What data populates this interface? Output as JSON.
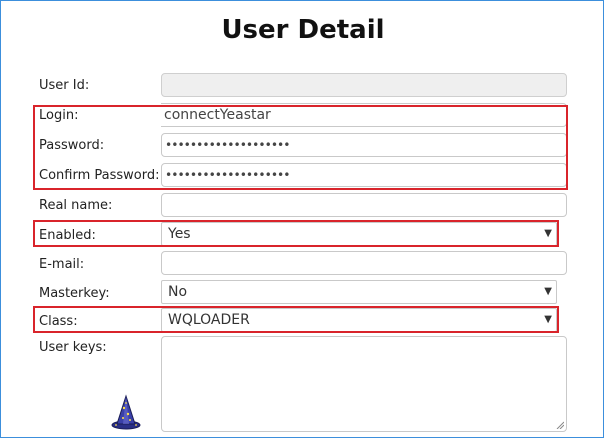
{
  "title": "User Detail",
  "form": {
    "user_id": {
      "label": "User Id:",
      "value": ""
    },
    "login": {
      "label": "Login:",
      "value": "connectYeastar"
    },
    "password": {
      "label": "Password:",
      "value": "••••••••••••••••••••"
    },
    "confirm_password": {
      "label": "Confirm Password:",
      "value": "••••••••••••••••••••"
    },
    "real_name": {
      "label": "Real name:",
      "value": ""
    },
    "enabled": {
      "label": "Enabled:",
      "value": "Yes"
    },
    "email": {
      "label": "E-mail:",
      "value": ""
    },
    "masterkey": {
      "label": "Masterkey:",
      "value": "No"
    },
    "class": {
      "label": "Class:",
      "value": "WQLOADER"
    },
    "user_keys": {
      "label": "User keys:",
      "value": ""
    }
  },
  "icons": {
    "select_arrow": "▼",
    "wizard": "wizard-hat-icon"
  },
  "colors": {
    "highlight": "#d9242b",
    "frame": "#3c8fdc"
  }
}
